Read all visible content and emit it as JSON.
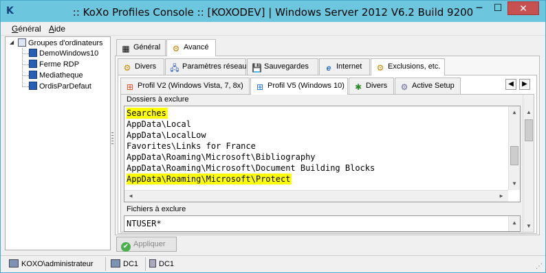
{
  "window": {
    "title": ":: KoXo Profiles Console :: [KOXODEV]  | Windows Server 2012 V6.2 Build 9200",
    "app_icon": "K",
    "minimize": "─",
    "maximize": "☐",
    "close": "✕"
  },
  "menu": {
    "items": [
      {
        "label": "Général",
        "underline": "G",
        "rest": "énéral"
      },
      {
        "label": "Aide",
        "underline": "A",
        "rest": "ide"
      }
    ]
  },
  "tree": {
    "root": "Groupes d'ordinateurs",
    "expander": "◢",
    "children": [
      "DemoWindows10",
      "Ferme RDP",
      "Mediatheque",
      "OrdisParDefaut"
    ]
  },
  "tabs_level1": [
    {
      "label": "Général",
      "icon": "▦"
    },
    {
      "label": "Avancé",
      "icon": "⚙"
    }
  ],
  "tabs_level2": [
    {
      "label": "Divers",
      "icon": "⚙"
    },
    {
      "label": "Paramètres réseau",
      "icon": "🖧"
    },
    {
      "label": "Sauvegardes",
      "icon": "💾"
    },
    {
      "label": "Internet",
      "icon": "e"
    },
    {
      "label": "Exclusions, etc.",
      "icon": "⚙"
    }
  ],
  "tabs_level3": [
    {
      "label": "Profil V2 (Windows Vista, 7, 8x)",
      "icon": "⊞"
    },
    {
      "label": "Profil V5 (Windows 10)",
      "icon": "⊞"
    },
    {
      "label": "Divers",
      "icon": "✱"
    },
    {
      "label": "Active Setup",
      "icon": "⚙"
    }
  ],
  "tab_nav": {
    "prev": "◀",
    "next": "▶"
  },
  "folders_group": {
    "label": "Dossiers à exclure",
    "lines": [
      {
        "text": "Searches",
        "highlight": true
      },
      {
        "text": "AppData\\Local",
        "highlight": false
      },
      {
        "text": "AppData\\LocalLow",
        "highlight": false
      },
      {
        "text": "Favorites\\Links for France",
        "highlight": false
      },
      {
        "text": "AppData\\Roaming\\Microsoft\\Bibliography",
        "highlight": false
      },
      {
        "text": "AppData\\Roaming\\Microsoft\\Document Building Blocks",
        "highlight": false
      },
      {
        "text": "AppData\\Roaming\\Microsoft\\Protect",
        "highlight": true
      }
    ]
  },
  "files_group": {
    "label": "Fichiers à exclure",
    "lines": [
      {
        "text": "NTUSER*",
        "highlight": false
      }
    ]
  },
  "apply_button": {
    "label": "Appliquer",
    "icon": "✔"
  },
  "status": {
    "user": "KOXO\\administrateur",
    "dc1": "DC1",
    "dc2": "DC1",
    "grip": "⋰"
  },
  "scroll": {
    "up": "▲",
    "down": "▼",
    "left": "◀",
    "right": "▶"
  },
  "colors": {
    "highlight": "#ffff00",
    "titlebar": "#6cc6dd",
    "close": "#c75050"
  }
}
